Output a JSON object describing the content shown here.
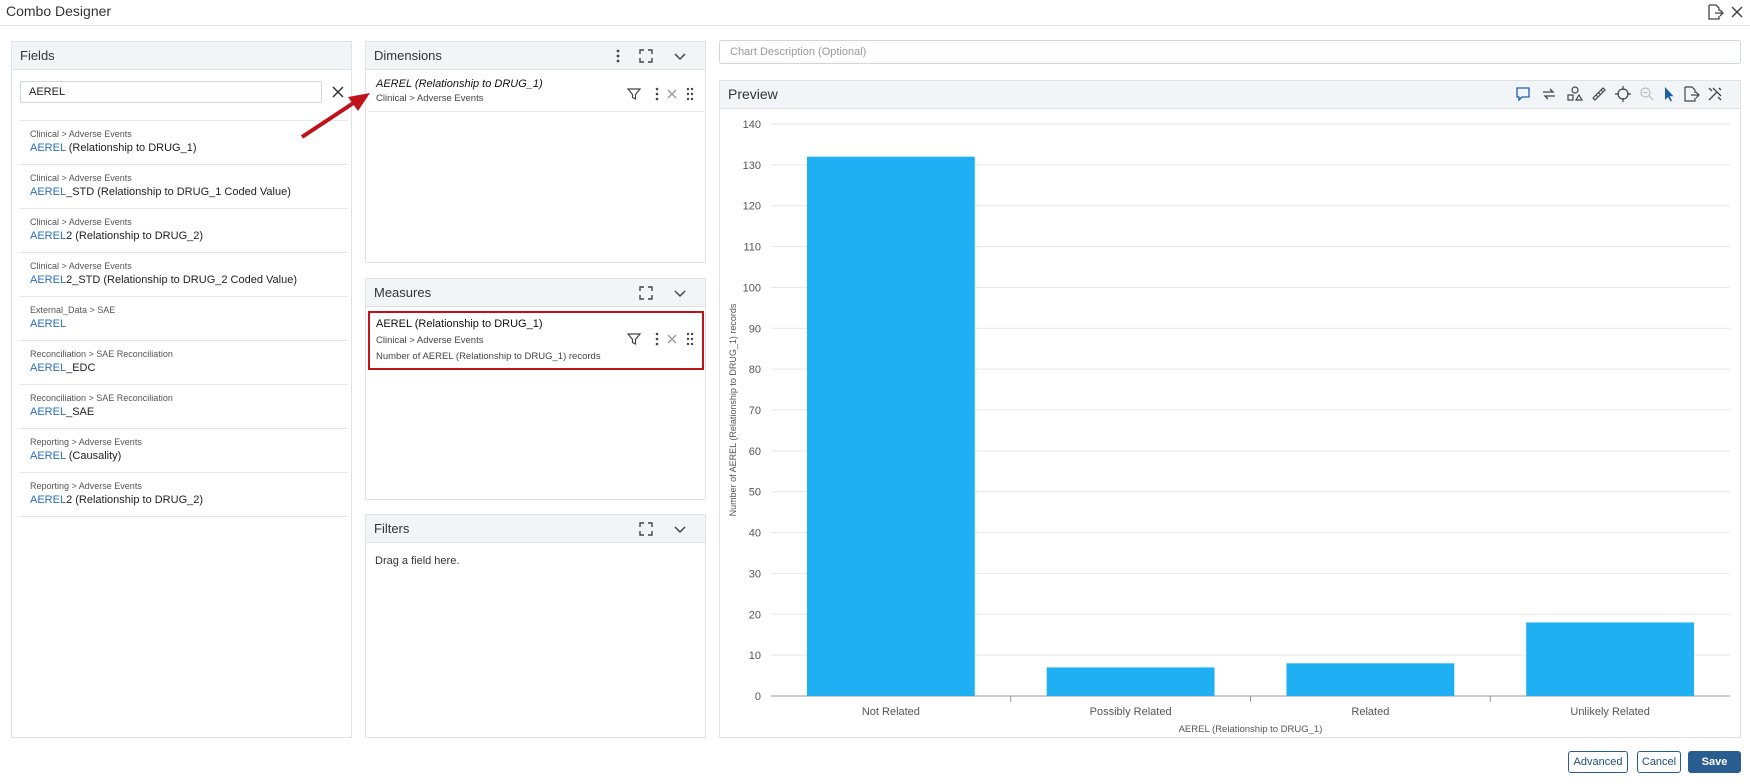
{
  "window": {
    "title": "Combo Designer"
  },
  "fields_panel": {
    "title": "Fields",
    "search_value": "AEREL",
    "items": [
      {
        "path": "Clinical > Adverse Events",
        "hl": "AEREL",
        "rest": " (Relationship to DRUG_1)"
      },
      {
        "path": "Clinical > Adverse Events",
        "hl": "AEREL",
        "rest": "_STD (Relationship to DRUG_1 Coded Value)"
      },
      {
        "path": "Clinical > Adverse Events",
        "hl": "AEREL",
        "rest": "2 (Relationship to DRUG_2)"
      },
      {
        "path": "Clinical > Adverse Events",
        "hl": "AEREL",
        "rest": "2_STD (Relationship to DRUG_2 Coded Value)"
      },
      {
        "path": "External_Data > SAE",
        "hl": "AEREL",
        "rest": ""
      },
      {
        "path": "Reconciliation > SAE Reconciliation",
        "hl": "AEREL",
        "rest": "_EDC"
      },
      {
        "path": "Reconciliation > SAE Reconciliation",
        "hl": "AEREL",
        "rest": "_SAE"
      },
      {
        "path": "Reporting > Adverse Events",
        "hl": "AEREL",
        "rest": " (Causality)"
      },
      {
        "path": "Reporting > Adverse Events",
        "hl": "AEREL",
        "rest": "2 (Relationship to DRUG_2)"
      }
    ]
  },
  "dimensions_panel": {
    "title": "Dimensions",
    "item": {
      "name": "AEREL (Relationship to DRUG_1)",
      "path": "Clinical > Adverse Events"
    }
  },
  "measures_panel": {
    "title": "Measures",
    "item": {
      "name": "AEREL (Relationship to DRUG_1)",
      "path": "Clinical > Adverse Events",
      "description": "Number of AEREL (Relationship to DRUG_1) records"
    }
  },
  "filters_panel": {
    "title": "Filters",
    "placeholder": "Drag a field here."
  },
  "chart_description": {
    "placeholder": "Chart Description (Optional)"
  },
  "preview": {
    "title": "Preview"
  },
  "colors": {
    "bar": "#1eb0f3",
    "accent": "#2a5d8f",
    "highlight_box": "#c0121b",
    "link": "#2a6fb8"
  },
  "chart_data": {
    "type": "bar",
    "categories": [
      "Not Related",
      "Possibly Related",
      "Related",
      "Unlikely Related"
    ],
    "values": [
      132,
      7,
      8,
      18
    ],
    "xlabel": "AEREL  (Relationship to DRUG_1)",
    "ylabel": "Number of AEREL  (Relationship to DRUG_1) records",
    "ylim": [
      0,
      140
    ],
    "yticks": [
      0,
      10,
      20,
      30,
      40,
      50,
      60,
      70,
      80,
      90,
      100,
      110,
      120,
      130,
      140
    ],
    "grid": true,
    "legend": "none"
  },
  "buttons": {
    "advanced": "Advanced",
    "cancel": "Cancel",
    "save": "Save"
  }
}
